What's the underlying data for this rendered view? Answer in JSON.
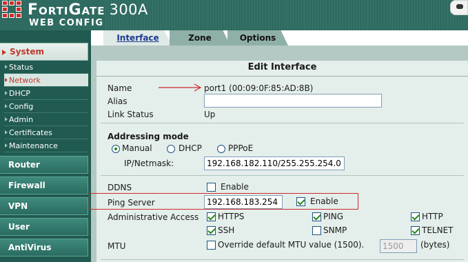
{
  "header": {
    "brand": "FortiGate",
    "model": "300A",
    "subtitle": "WEB CONFIG"
  },
  "sidebar": {
    "sections": [
      {
        "label": "System",
        "active": true
      },
      {
        "label": "Router"
      },
      {
        "label": "Firewall"
      },
      {
        "label": "VPN"
      },
      {
        "label": "User"
      },
      {
        "label": "AntiVirus"
      }
    ],
    "system_items": [
      {
        "label": "Status"
      },
      {
        "label": "Network",
        "active": true
      },
      {
        "label": "DHCP"
      },
      {
        "label": "Config"
      },
      {
        "label": "Admin"
      },
      {
        "label": "Certificates"
      },
      {
        "label": "Maintenance"
      }
    ]
  },
  "tabs": [
    {
      "label": "Interface",
      "active": true
    },
    {
      "label": "Zone"
    },
    {
      "label": "Options"
    }
  ],
  "form": {
    "title": "Edit Interface",
    "name_label": "Name",
    "name_value": "port1 (00:09:0F:85:AD:8B)",
    "alias_label": "Alias",
    "alias_value": "",
    "link_status_label": "Link Status",
    "link_status_value": "Up",
    "addressing_label": "Addressing mode",
    "addressing_options": [
      {
        "label": "Manual",
        "checked": true
      },
      {
        "label": "DHCP",
        "checked": false
      },
      {
        "label": "PPPoE",
        "checked": false
      }
    ],
    "ip_label": "IP/Netmask:",
    "ip_value": "192.168.182.110/255.255.254.0",
    "ddns_label": "DDNS",
    "ddns_enable_label": "Enable",
    "ddns_checked": false,
    "ping_label": "Ping Server",
    "ping_value": "192.168.183.254",
    "ping_enable_label": "Enable",
    "ping_checked": true,
    "admin_access_label": "Administrative Access",
    "admin_access": [
      {
        "label": "HTTPS",
        "checked": true
      },
      {
        "label": "PING",
        "checked": true
      },
      {
        "label": "HTTP",
        "checked": true
      },
      {
        "label": "SSH",
        "checked": true
      },
      {
        "label": "SNMP",
        "checked": false
      },
      {
        "label": "TELNET",
        "checked": true
      }
    ],
    "mtu_label": "MTU",
    "mtu_override_label": "Override default MTU value (1500).",
    "mtu_override_checked": false,
    "mtu_value": "1500",
    "mtu_unit": "(bytes)"
  },
  "colors": {
    "header_bg": "#2f6b60",
    "sidebar_bg": "#215a50",
    "panel_bg": "#e4eeeb",
    "annotation": "#cc2a2a",
    "check_color": "#1e8a1e"
  }
}
